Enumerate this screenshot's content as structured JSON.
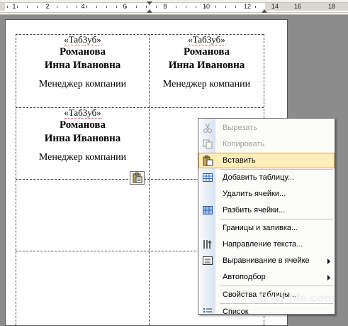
{
  "ruler": {
    "numbers": [
      "1",
      "2",
      "4",
      "6",
      "8",
      "10",
      "12",
      "14",
      "16",
      "18"
    ]
  },
  "labels": [
    {
      "tag": "«Таб3уб»",
      "name_line1": "Романова",
      "name_line2": "Инна Ивановна",
      "role": "Менеджер компании"
    },
    {
      "tag": "«Таб3уб»",
      "name_line1": "Романова",
      "name_line2": "Инна Ивановна",
      "role": "Менеджер компании"
    },
    {
      "tag": "«Таб3уб»",
      "name_line1": "Романова",
      "name_line2": "Инна Ивановна",
      "role": "Менеджер компании"
    }
  ],
  "context_menu": {
    "items": [
      {
        "label": "Вырезать",
        "icon": "scissors-icon",
        "disabled": true
      },
      {
        "label": "Копировать",
        "icon": "copy-icon",
        "disabled": true
      },
      {
        "label": "Вставить",
        "icon": "paste-icon",
        "highlighted": true
      },
      {
        "label": "Добавить таблицу...",
        "icon": "insert-table-icon"
      },
      {
        "label": "Удалить ячейки..."
      },
      {
        "label": "Разбить ячейки...",
        "icon": "split-cells-icon"
      },
      {
        "label": "Границы и заливка..."
      },
      {
        "label": "Направление текста...",
        "icon": "text-direction-icon"
      },
      {
        "label": "Выравнивание в ячейке",
        "icon": "cell-alignment-icon",
        "submenu": true
      },
      {
        "label": "Автоподбор",
        "submenu": true
      },
      {
        "label": "Свойства таблицы..."
      },
      {
        "label": "Список",
        "icon": "list-icon"
      }
    ]
  },
  "watermark": "User-life.com",
  "colors": {
    "highlight": "#ffeebb",
    "highlight_border": "#d4a83a",
    "gutter": "#d6e3f6"
  }
}
